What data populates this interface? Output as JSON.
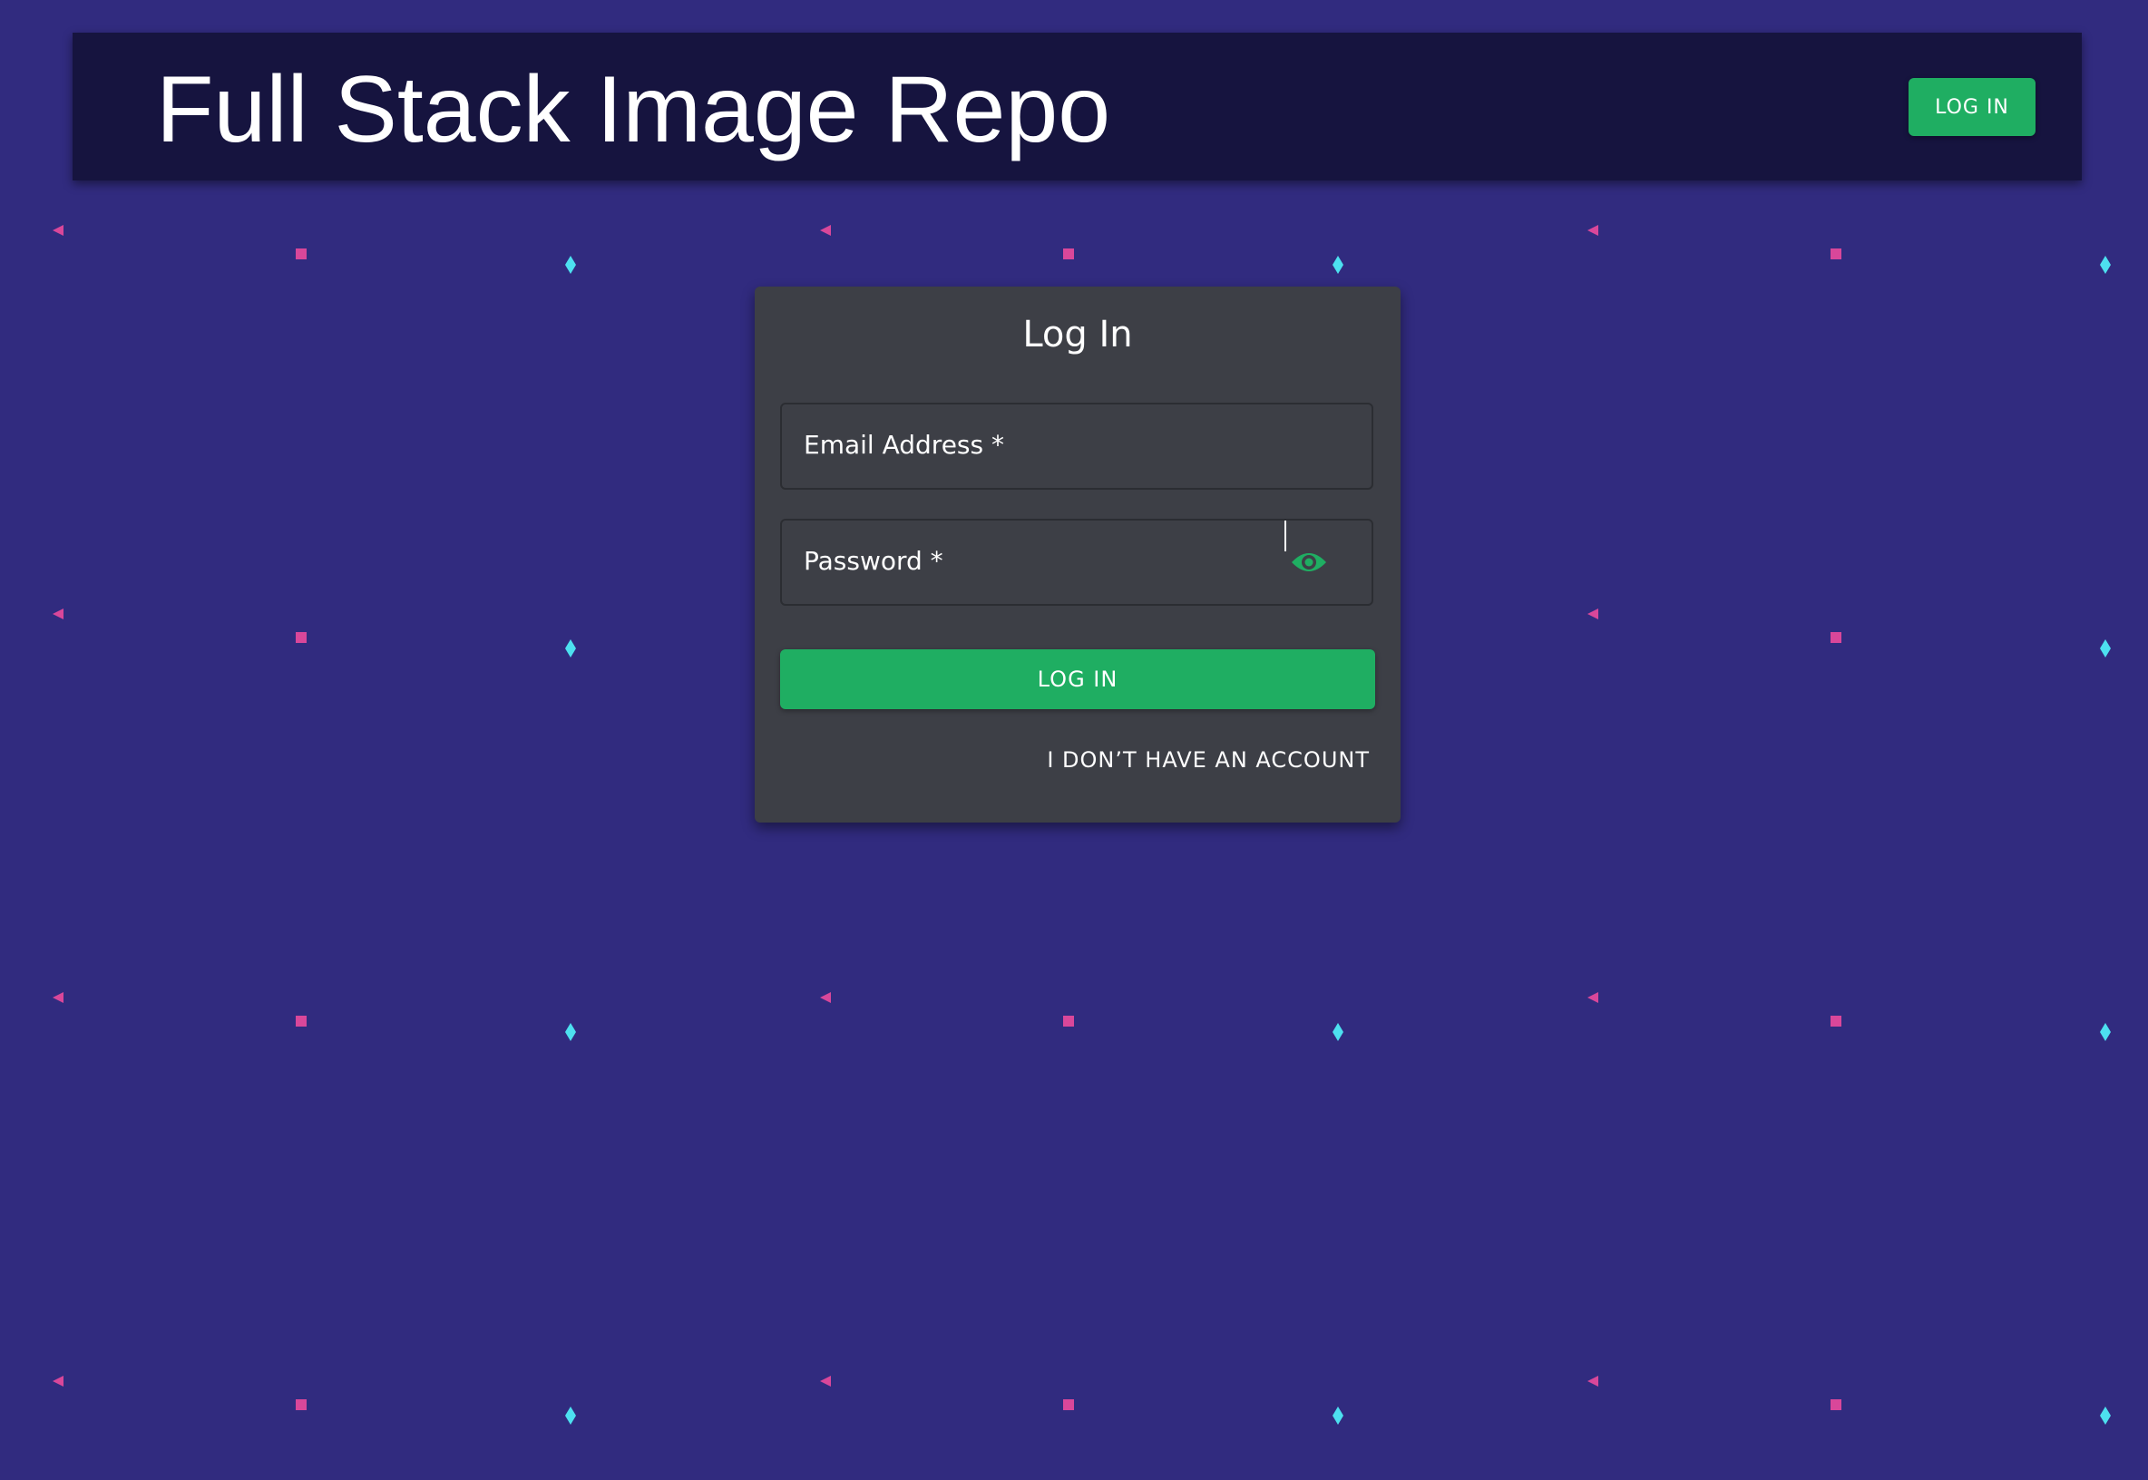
{
  "header": {
    "title": "Full Stack Image Repo",
    "login_label": "LOG IN"
  },
  "login_form": {
    "title": "Log In",
    "email_label": "Email Address *",
    "email_value": "",
    "password_label": "Password *",
    "password_value": "",
    "password_visibility_icon": "eye-icon",
    "submit_label": "LOG IN",
    "no_account_label": "I DON’T HAVE AN ACCOUNT"
  },
  "colors": {
    "background": "#312b7f",
    "app_bar": "#16143f",
    "card": "#3d3f46",
    "accent": "#1fae62",
    "confetti_pink": "#d9479a",
    "confetti_cyan": "#4de0f0"
  }
}
